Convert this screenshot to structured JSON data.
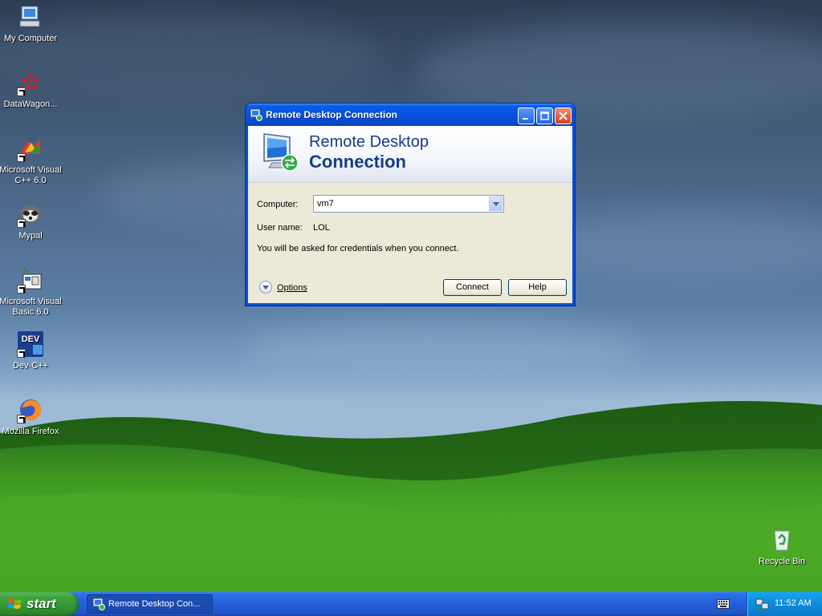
{
  "desktop": {
    "icons": [
      {
        "label": "My Computer",
        "icon": "my-computer-icon"
      },
      {
        "label": "DataWagon...",
        "icon": "datawagon-icon"
      },
      {
        "label": "Microsoft Visual C++ 6.0",
        "icon": "visual-cpp-icon"
      },
      {
        "label": "Mypal",
        "icon": "mypal-icon"
      },
      {
        "label": "Microsoft Visual Basic 6.0",
        "icon": "visual-basic-icon"
      },
      {
        "label": "Dev-C++",
        "icon": "dev-cpp-icon"
      },
      {
        "label": "Mozilla Firefox",
        "icon": "firefox-icon"
      },
      {
        "label": "Recycle Bin",
        "icon": "recycle-bin-icon"
      }
    ]
  },
  "window": {
    "title": "Remote Desktop Connection",
    "banner_line1": "Remote Desktop",
    "banner_line2": "Connection",
    "computer_label": "Computer:",
    "computer_value": "vm7",
    "username_label": "User name:",
    "username_value": "LOL",
    "info_text": "You will be asked for credentials when you connect.",
    "options_label": "Options",
    "connect_label": "Connect",
    "help_label": "Help"
  },
  "taskbar": {
    "start_label": "start",
    "task_label": "Remote Desktop Con...",
    "clock": "11:52 AM"
  },
  "colors": {
    "titlebar": "#0a53e0",
    "taskbar": "#245fd9",
    "start": "#3fa63f",
    "tray": "#0f8bdc",
    "dialog": "#ece9d8"
  }
}
